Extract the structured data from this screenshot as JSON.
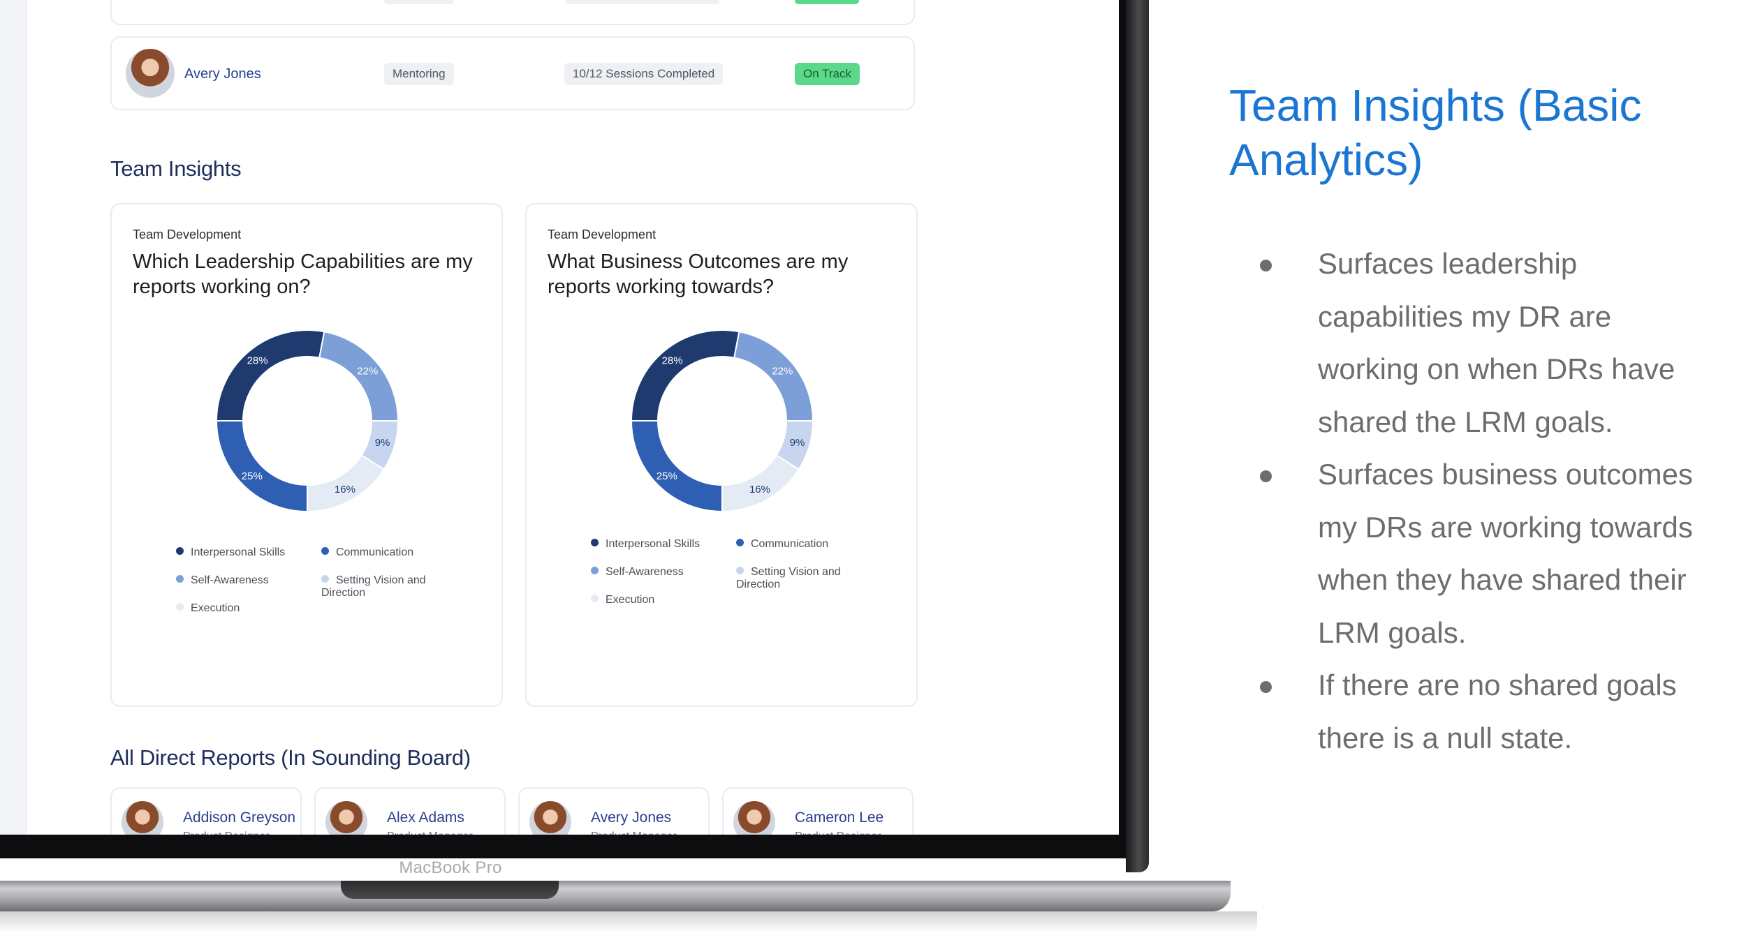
{
  "laptop": {
    "model_label": "MacBook Pro"
  },
  "screen": {
    "mentoring_row": {
      "name": "Avery Jones",
      "program": "Mentoring",
      "progress": "10/12 Sessions Completed",
      "status": "On Track",
      "status_color": "#5bd98a"
    },
    "team_insights": {
      "heading": "Team Insights",
      "cards": [
        {
          "eyebrow": "Team Development",
          "question": "Which Leadership Capabilities are my reports working on?"
        },
        {
          "eyebrow": "Team Development",
          "question": "What Business Outcomes are my reports working towards?"
        }
      ]
    },
    "all_direct_reports": {
      "heading": "All Direct Reports (In Sounding Board)",
      "reports": [
        {
          "name": "Addison Greyson",
          "role": "Product Designer"
        },
        {
          "name": "Alex Adams",
          "role": "Product Manager"
        },
        {
          "name": "Avery Jones",
          "role": "Product Manager"
        },
        {
          "name": "Cameron Lee",
          "role": "Product Designer"
        }
      ]
    }
  },
  "chart_data": [
    {
      "type": "pie",
      "title": "Which Leadership Capabilities are my reports working on?",
      "categories": [
        "Interpersonal Skills",
        "Communication",
        "Self-Awareness",
        "Setting Vision and Direction",
        "Execution"
      ],
      "values": [
        28,
        25,
        22,
        9,
        16
      ],
      "value_labels": [
        "28%",
        "25%",
        "22%",
        "9%",
        "16%"
      ],
      "colors": [
        "#1e3a6e",
        "#2e5fb3",
        "#7b9fd6",
        "#c7d6ee",
        "#e4ebf5"
      ],
      "legend_labels": [
        "Interpersonal Skills",
        "Communication",
        "Self-Awareness",
        "Setting Vision and Direction",
        "Execution"
      ],
      "style": "donut"
    },
    {
      "type": "pie",
      "title": "What Business Outcomes are my reports working towards?",
      "categories": [
        "Interpersonal Skills",
        "Communication",
        "Self-Awareness",
        "Setting Vision and Direction",
        "Execution"
      ],
      "values": [
        28,
        25,
        22,
        9,
        16
      ],
      "value_labels": [
        "28%",
        "25%",
        "22%",
        "9%",
        "16%"
      ],
      "colors": [
        "#1e3a6e",
        "#2e5fb3",
        "#7b9fd6",
        "#c7d6ee",
        "#e4ebf5"
      ],
      "legend_labels": [
        "Interpersonal Skills",
        "Communication",
        "Self-Awareness",
        "Setting Vision and Direction",
        "Execution"
      ],
      "style": "donut"
    }
  ],
  "slide": {
    "title": "Team Insights (Basic Analytics)",
    "title_color": "#1a76d2",
    "bullets": [
      "Surfaces leadership capabilities my DR are working on when DRs have shared the LRM goals.",
      "Surfaces business outcomes my DRs are working towards when they have shared their LRM goals.",
      "If there are no shared goals there is a null state."
    ]
  }
}
